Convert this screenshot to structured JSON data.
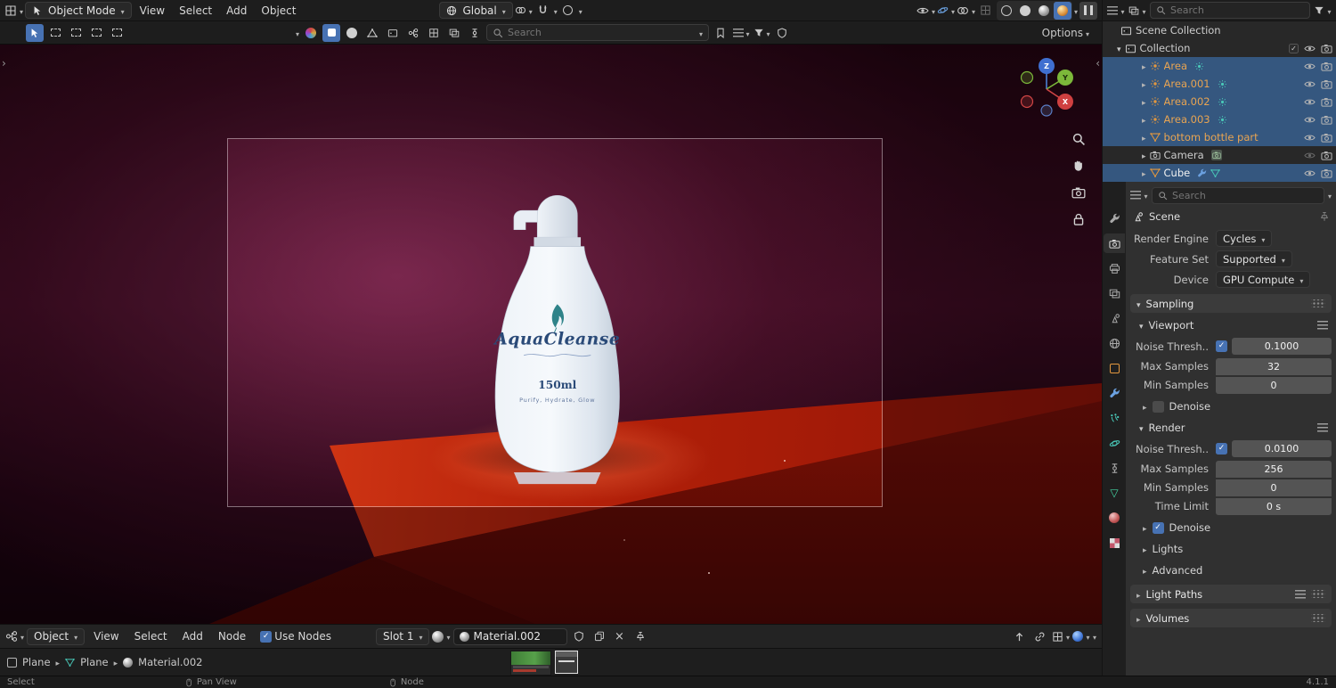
{
  "topbar": {
    "mode_label": "Object Mode",
    "menus": [
      "View",
      "Select",
      "Add",
      "Object"
    ],
    "orientation_label": "Global"
  },
  "toolrow": {
    "search_placeholder": "Search",
    "options_label": "Options"
  },
  "viewport": {
    "gizmo": {
      "x": "X",
      "y": "Y",
      "z": "Z"
    },
    "bottle": {
      "brand": "AquaCleanse",
      "volume": "150ml",
      "tagline": "Purify, Hydrate, Glow"
    }
  },
  "outliner": {
    "search_placeholder": "Search",
    "rows": [
      {
        "label": "Scene Collection"
      },
      {
        "label": "Collection"
      },
      {
        "label": "Area"
      },
      {
        "label": "Area.001"
      },
      {
        "label": "Area.002"
      },
      {
        "label": "Area.003"
      },
      {
        "label": "bottom bottle part"
      },
      {
        "label": "Camera"
      },
      {
        "label": "Cube"
      }
    ]
  },
  "properties": {
    "search_placeholder": "Search",
    "context_label": "Scene",
    "engine_label": "Render Engine",
    "engine_value": "Cycles",
    "feature_label": "Feature Set",
    "feature_value": "Supported",
    "device_label": "Device",
    "device_value": "GPU Compute",
    "sampling_title": "Sampling",
    "viewport_title": "Viewport",
    "vp_noise_label": "Noise Thresh..",
    "vp_noise_value": "0.1000",
    "vp_max_label": "Max Samples",
    "vp_max_value": "32",
    "vp_min_label": "Min Samples",
    "vp_min_value": "0",
    "vp_denoise_label": "Denoise",
    "render_title": "Render",
    "r_noise_label": "Noise Thresh..",
    "r_noise_value": "0.0100",
    "r_max_label": "Max Samples",
    "r_max_value": "256",
    "r_min_label": "Min Samples",
    "r_min_value": "0",
    "r_time_label": "Time Limit",
    "r_time_value": "0 s",
    "r_denoise_label": "Denoise",
    "lights_label": "Lights",
    "advanced_label": "Advanced",
    "light_paths_title": "Light Paths",
    "volumes_title": "Volumes"
  },
  "shader": {
    "mode_label": "Object",
    "menus": [
      "View",
      "Select",
      "Add",
      "Node"
    ],
    "use_nodes_label": "Use Nodes",
    "slot_label": "Slot 1",
    "material_name": "Material.002"
  },
  "path_bar": {
    "items": [
      "Plane",
      "Plane",
      "Material.002"
    ]
  },
  "statusbar": {
    "select_label": "Select",
    "pan_label": "Pan View",
    "node_label": "Node",
    "version": "4.1.1"
  }
}
